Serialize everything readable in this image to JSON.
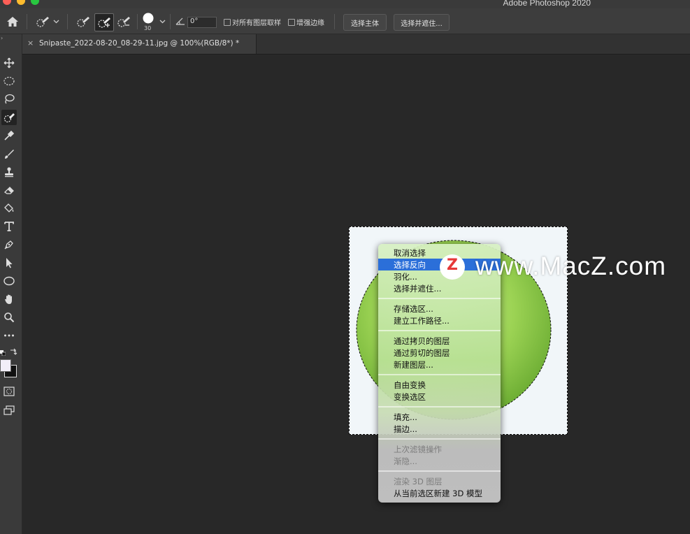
{
  "window": {
    "app_title": "Adobe Photoshop 2020"
  },
  "options_bar": {
    "brush_size": "30",
    "angle_value": "0°",
    "sample_all_layers_label": "对所有图层取样",
    "enhance_edge_label": "增强边缘",
    "select_subject_label": "选择主体",
    "select_and_mask_label": "选择并遮住..."
  },
  "document_tab": {
    "title": "Snipaste_2022-08-20_08-29-11.jpg @ 100%(RGB/8*) *",
    "close_glyph": "×"
  },
  "context_menu": {
    "groups": [
      [
        {
          "label": "取消选择",
          "state": "normal"
        },
        {
          "label": "选择反向",
          "state": "highlighted"
        },
        {
          "label": "羽化...",
          "state": "normal"
        },
        {
          "label": "选择并遮住...",
          "state": "normal"
        }
      ],
      [
        {
          "label": "存储选区...",
          "state": "normal"
        },
        {
          "label": "建立工作路径...",
          "state": "normal"
        }
      ],
      [
        {
          "label": "通过拷贝的图层",
          "state": "normal"
        },
        {
          "label": "通过剪切的图层",
          "state": "normal"
        },
        {
          "label": "新建图层...",
          "state": "normal"
        }
      ],
      [
        {
          "label": "自由变换",
          "state": "normal"
        },
        {
          "label": "变换选区",
          "state": "normal"
        }
      ],
      [
        {
          "label": "填充...",
          "state": "normal"
        },
        {
          "label": "描边...",
          "state": "normal"
        }
      ],
      [
        {
          "label": "上次滤镜操作",
          "state": "disabled"
        },
        {
          "label": "渐隐...",
          "state": "disabled"
        }
      ],
      [
        {
          "label": "渲染 3D 图层",
          "state": "disabled"
        },
        {
          "label": "从当前选区新建 3D 模型",
          "state": "normal"
        }
      ]
    ]
  },
  "watermark": {
    "logo_letter": "Z",
    "text": "www.MacZ.com"
  },
  "colors": {
    "highlight": "#2b6fd9",
    "watermark_logo": "#e63838",
    "apple_green": "#8cc540"
  },
  "toolbar": {
    "tools": [
      "move-tool-icon",
      "marquee-tool-icon",
      "lasso-tool-icon",
      "quick-selection-tool-icon",
      "eyedropper-tool-icon",
      "brush-tool-icon",
      "stamp-tool-icon",
      "eraser-tool-icon",
      "paint-bucket-tool-icon",
      "type-tool-icon",
      "pen-tool-icon",
      "path-selection-tool-icon",
      "ellipse-tool-icon",
      "hand-tool-icon",
      "zoom-tool-icon",
      "more-tools-icon"
    ],
    "active_tool": "quick-selection-tool-icon"
  }
}
